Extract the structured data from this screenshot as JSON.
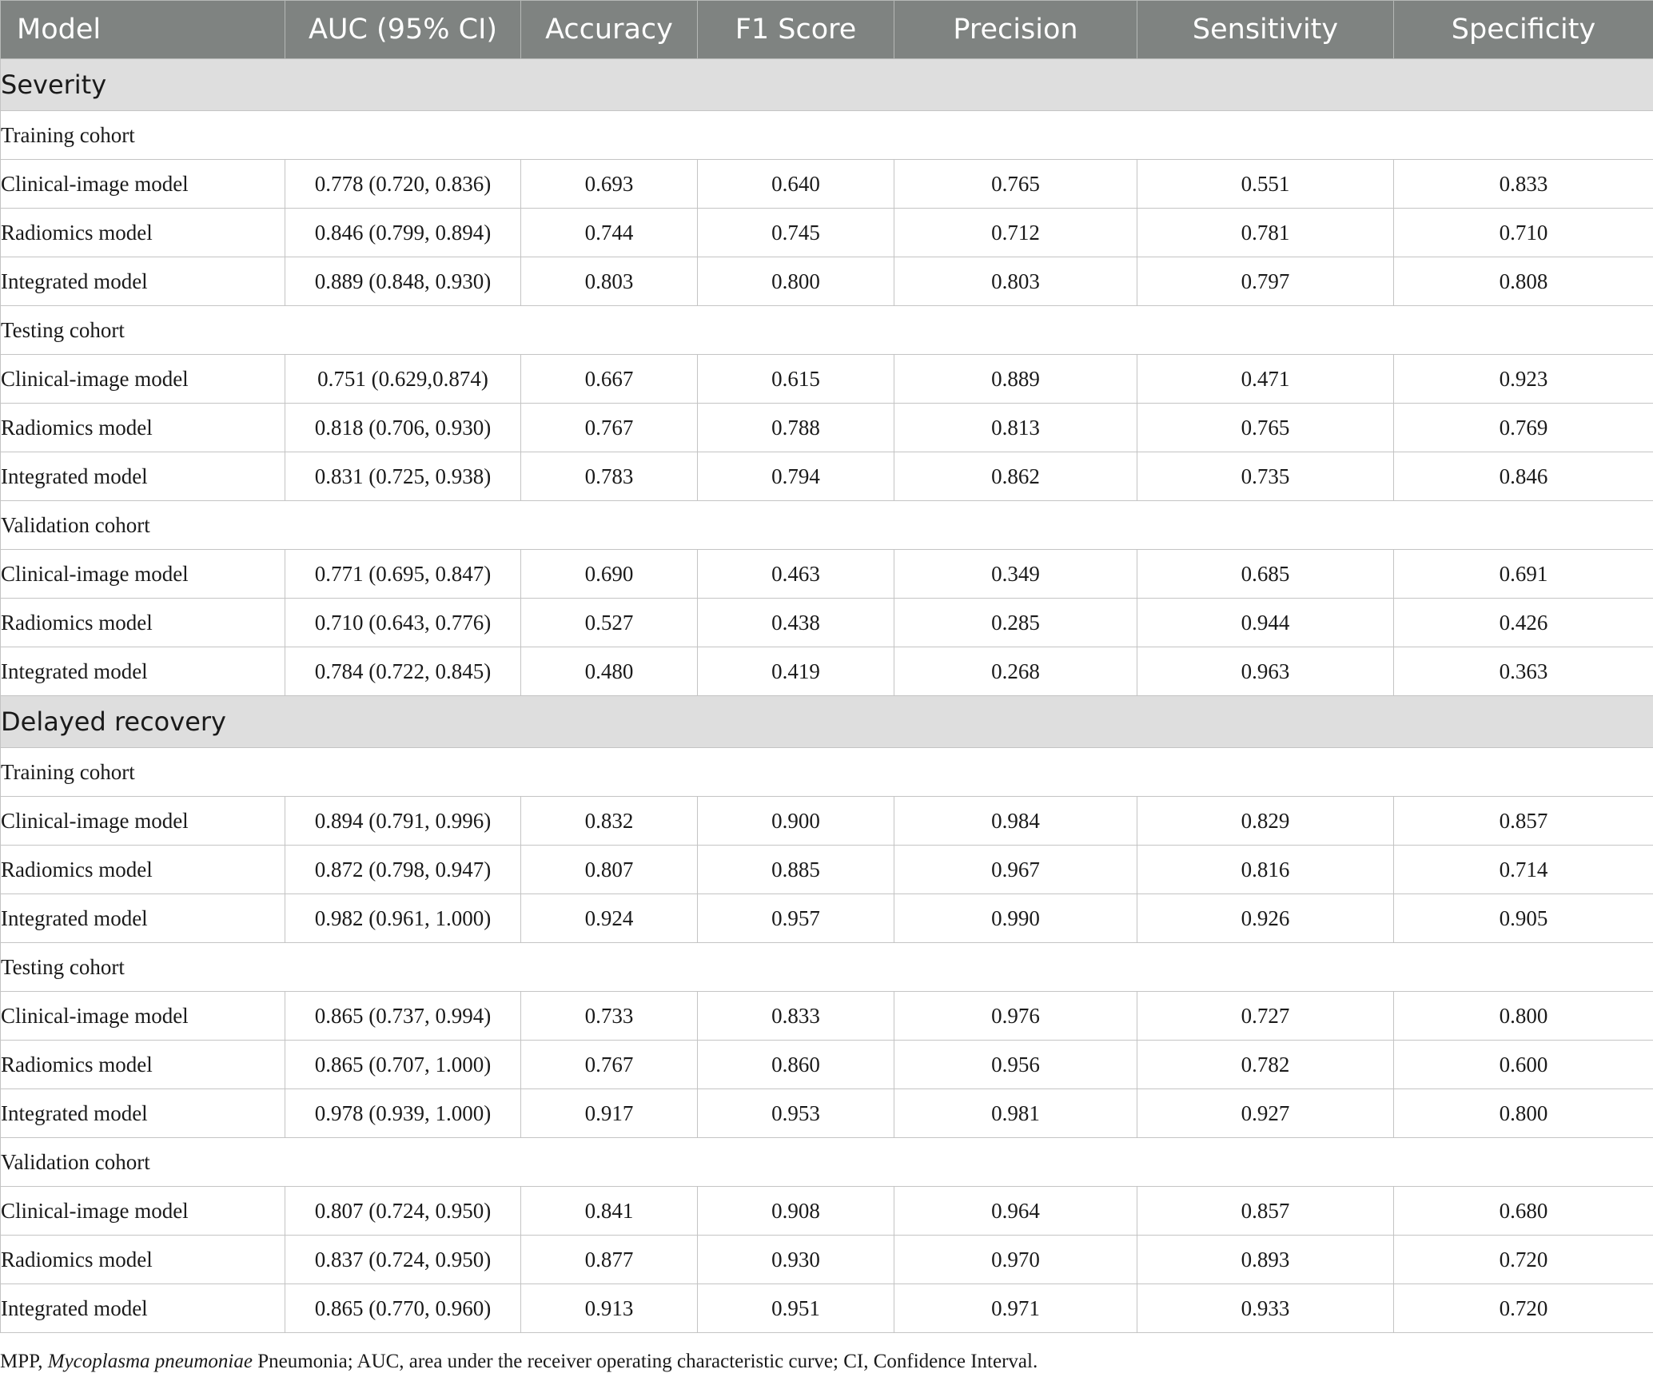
{
  "header": [
    "Model",
    "AUC (95% CI)",
    "Accuracy",
    "F1 Score",
    "Precision",
    "Sensitivity",
    "Specificity"
  ],
  "sections": [
    {
      "title": "Severity",
      "cohorts": [
        {
          "name": "Training cohort",
          "rows": [
            [
              "Clinical-image model",
              "0.778 (0.720, 0.836)",
              "0.693",
              "0.640",
              "0.765",
              "0.551",
              "0.833"
            ],
            [
              "Radiomics model",
              "0.846 (0.799, 0.894)",
              "0.744",
              "0.745",
              "0.712",
              "0.781",
              "0.710"
            ],
            [
              "Integrated model",
              "0.889 (0.848, 0.930)",
              "0.803",
              "0.800",
              "0.803",
              "0.797",
              "0.808"
            ]
          ]
        },
        {
          "name": "Testing cohort",
          "rows": [
            [
              "Clinical-image model",
              "0.751 (0.629,0.874)",
              "0.667",
              "0.615",
              "0.889",
              "0.471",
              "0.923"
            ],
            [
              "Radiomics model",
              "0.818 (0.706, 0.930)",
              "0.767",
              "0.788",
              "0.813",
              "0.765",
              "0.769"
            ],
            [
              "Integrated model",
              "0.831 (0.725, 0.938)",
              "0.783",
              "0.794",
              "0.862",
              "0.735",
              "0.846"
            ]
          ]
        },
        {
          "name": "Validation cohort",
          "rows": [
            [
              "Clinical-image model",
              "0.771 (0.695, 0.847)",
              "0.690",
              "0.463",
              "0.349",
              "0.685",
              "0.691"
            ],
            [
              "Radiomics model",
              "0.710 (0.643, 0.776)",
              "0.527",
              "0.438",
              "0.285",
              "0.944",
              "0.426"
            ],
            [
              "Integrated model",
              "0.784 (0.722, 0.845)",
              "0.480",
              "0.419",
              "0.268",
              "0.963",
              "0.363"
            ]
          ]
        }
      ]
    },
    {
      "title": "Delayed recovery",
      "cohorts": [
        {
          "name": "Training cohort",
          "rows": [
            [
              "Clinical-image model",
              "0.894 (0.791, 0.996)",
              "0.832",
              "0.900",
              "0.984",
              "0.829",
              "0.857"
            ],
            [
              "Radiomics model",
              "0.872 (0.798, 0.947)",
              "0.807",
              "0.885",
              "0.967",
              "0.816",
              "0.714"
            ],
            [
              "Integrated model",
              "0.982 (0.961, 1.000)",
              "0.924",
              "0.957",
              "0.990",
              "0.926",
              "0.905"
            ]
          ]
        },
        {
          "name": "Testing cohort",
          "rows": [
            [
              "Clinical-image model",
              "0.865 (0.737, 0.994)",
              "0.733",
              "0.833",
              "0.976",
              "0.727",
              "0.800"
            ],
            [
              "Radiomics model",
              "0.865 (0.707, 1.000)",
              "0.767",
              "0.860",
              "0.956",
              "0.782",
              "0.600"
            ],
            [
              "Integrated model",
              "0.978 (0.939, 1.000)",
              "0.917",
              "0.953",
              "0.981",
              "0.927",
              "0.800"
            ]
          ]
        },
        {
          "name": "Validation cohort",
          "rows": [
            [
              "Clinical-image model",
              "0.807 (0.724, 0.950)",
              "0.841",
              "0.908",
              "0.964",
              "0.857",
              "0.680"
            ],
            [
              "Radiomics model",
              "0.837 (0.724, 0.950)",
              "0.877",
              "0.930",
              "0.970",
              "0.893",
              "0.720"
            ],
            [
              "Integrated model",
              "0.865 (0.770, 0.960)",
              "0.913",
              "0.951",
              "0.971",
              "0.933",
              "0.720"
            ]
          ]
        }
      ]
    }
  ],
  "footnote": {
    "part1": "MPP, ",
    "italic": "Mycoplasma pneumoniae",
    "part2": " Pneumonia; AUC, area under the receiver operating characteristic curve; CI, Confidence Interval."
  }
}
